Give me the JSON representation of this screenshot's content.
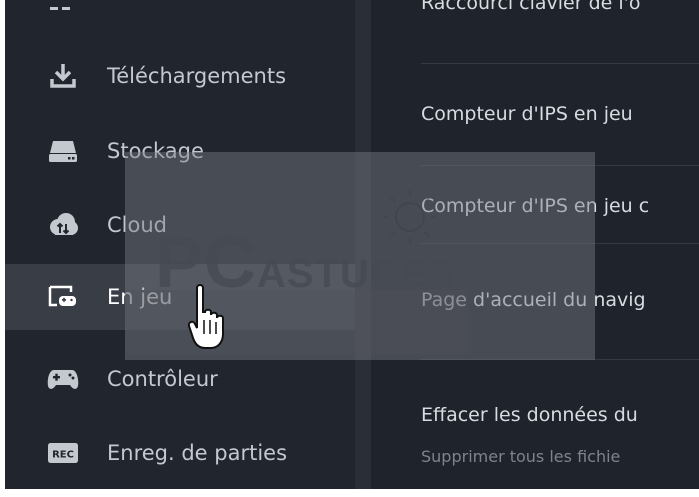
{
  "sidebar": {
    "items": [
      {
        "label": "Téléchargements",
        "icon": "download-icon"
      },
      {
        "label": "Stockage",
        "icon": "drive-icon"
      },
      {
        "label": "Cloud",
        "icon": "cloud-sync-icon"
      },
      {
        "label": "En jeu",
        "icon": "in-game-icon",
        "active": true
      },
      {
        "label": "Contrôleur",
        "icon": "gamepad-icon"
      },
      {
        "label": "Enreg. de parties",
        "icon": "rec-icon",
        "icon_text": "REC"
      }
    ]
  },
  "main": {
    "top_partial": "Raccourci clavier de l'o",
    "rows": [
      {
        "label": "Compteur d'IPS en jeu"
      },
      {
        "label": "Compteur d'IPS en jeu c"
      },
      {
        "label": "Page d'accueil du navig"
      },
      {
        "label": "Effacer les données du"
      }
    ],
    "description": "Supprimer tous les fichie"
  },
  "watermark": {
    "text_big": "PC",
    "text_small": "ASTUCES"
  },
  "colors": {
    "sidebar_bg": "#21252d",
    "active_bg": "#383d46",
    "main_bg": "#1f232b",
    "text": "#c4c8cf"
  }
}
